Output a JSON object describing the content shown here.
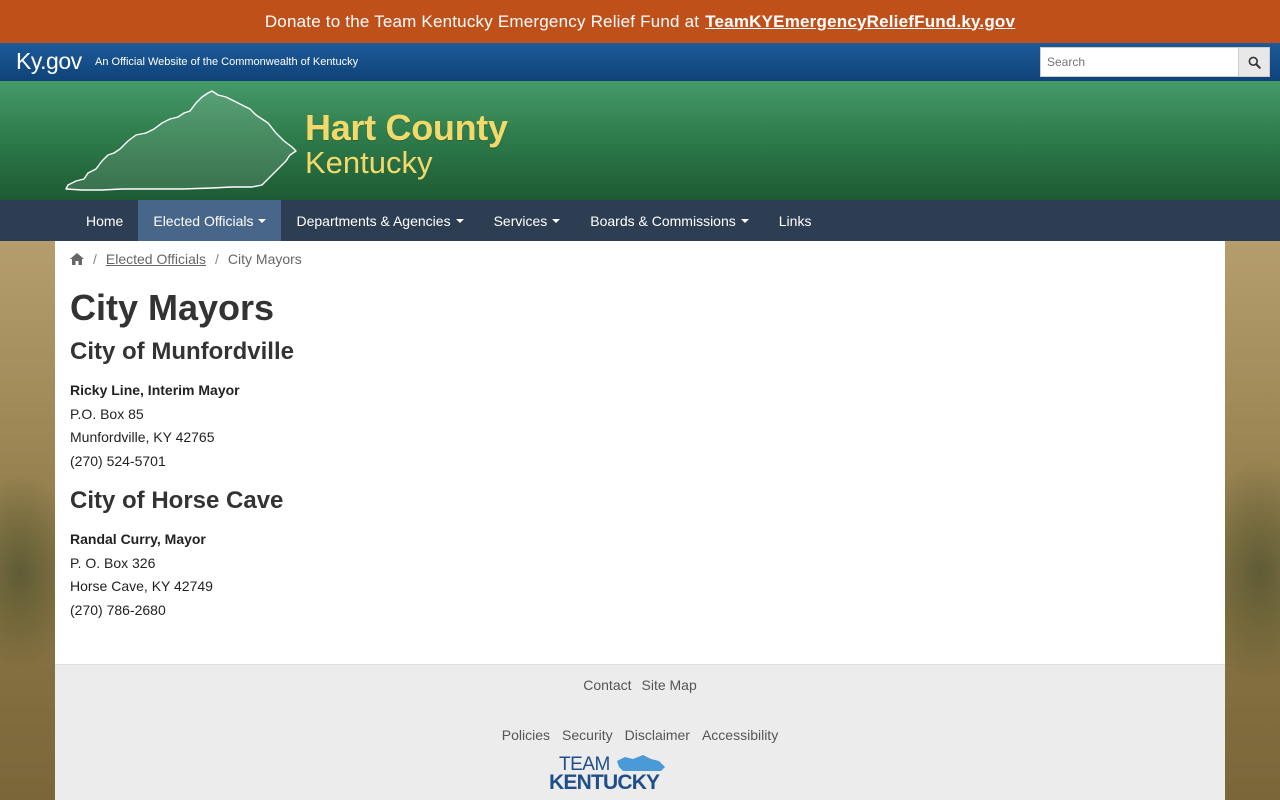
{
  "donate": {
    "text": "Donate to the Team Kentucky Emergency Relief Fund at",
    "link": "TeamKYEmergencyReliefFund.ky.gov"
  },
  "kygov": {
    "logo": "Ky.gov",
    "tagline": "An Official Website of the Commonwealth of Kentucky",
    "search_placeholder": "Search"
  },
  "banner": {
    "county": "Hart County",
    "state": "Kentucky"
  },
  "nav": {
    "items": [
      {
        "label": "Home",
        "dropdown": false,
        "active": false
      },
      {
        "label": "Elected Officials",
        "dropdown": true,
        "active": true
      },
      {
        "label": "Departments & Agencies",
        "dropdown": true,
        "active": false
      },
      {
        "label": "Services",
        "dropdown": true,
        "active": false
      },
      {
        "label": "Boards & Commissions",
        "dropdown": true,
        "active": false
      },
      {
        "label": "Links",
        "dropdown": false,
        "active": false
      }
    ]
  },
  "breadcrumb": {
    "home_icon": "home-icon",
    "parent": "Elected Officials",
    "current": "City Mayors"
  },
  "page": {
    "title": "City Mayors",
    "cities": [
      {
        "heading": "City of Munfordville",
        "name": "Ricky Line, Interim Mayor",
        "address1": "P.O. Box 85",
        "address2": "Munfordville, KY 42765",
        "phone": "(270) 524-5701"
      },
      {
        "heading": "City of Horse Cave",
        "name": "Randal Curry, Mayor",
        "address1": "P. O. Box 326",
        "address2": "Horse Cave, KY 42749",
        "phone": "(270) 786-2680"
      }
    ]
  },
  "footer": {
    "row1": [
      "Contact",
      "Site Map"
    ],
    "row2": [
      "Policies",
      "Security",
      "Disclaimer",
      "Accessibility"
    ],
    "logo_team": "TEAM",
    "logo_kentucky": "KENTUCKY"
  },
  "colors": {
    "donate_bg": "#c0501a",
    "kygov_bg": "#174e8a",
    "banner_green": "#2f7d4d",
    "county_gold": "#f2d96a",
    "nav_bg": "#2d3e52",
    "nav_active": "#486689",
    "team_blue": "#1f4f8a"
  }
}
